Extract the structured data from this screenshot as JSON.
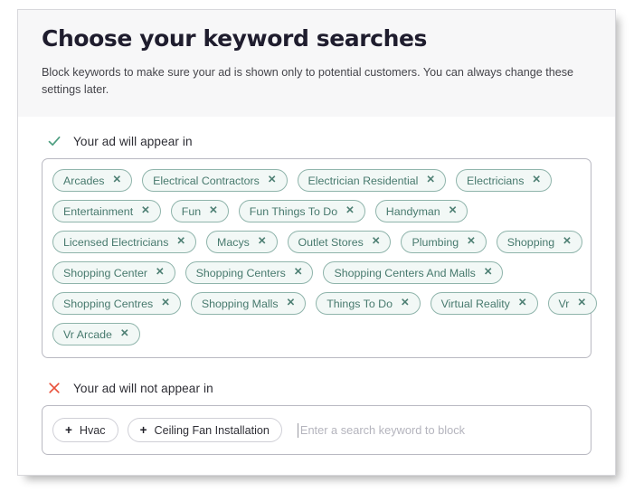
{
  "header": {
    "title": "Choose your keyword searches",
    "description": "Block keywords to make sure your ad is shown only to potential customers. You can always change these settings later."
  },
  "included": {
    "icon": "check-icon",
    "icon_color": "#4d9e80",
    "label": "Your ad will appear in",
    "remove_glyph": "✕",
    "rows": [
      [
        "Arcades",
        "Electrical Contractors",
        "Electrician Residential",
        "Electricians"
      ],
      [
        "Entertainment",
        "Fun",
        "Fun Things To Do",
        "Handyman"
      ],
      [
        "Licensed Electricians",
        "Macys",
        "Outlet Stores",
        "Plumbing",
        "Shopping"
      ],
      [
        "Shopping Center",
        "Shopping Centers",
        "Shopping Centers And Malls"
      ],
      [
        "Shopping Centres",
        "Shopping Malls",
        "Things To Do",
        "Virtual Reality",
        "Vr"
      ],
      [
        "Vr Arcade"
      ]
    ]
  },
  "blocked": {
    "icon": "close-icon",
    "icon_color": "#e8503a",
    "label": "Your ad will not appear in",
    "add_glyph": "+",
    "chips": [
      "Hvac",
      "Ceiling Fan Installation"
    ],
    "input_value": "",
    "input_placeholder": "Enter a search keyword to block"
  },
  "colors": {
    "chip_border": "#8fb4ab",
    "chip_bg": "#f2f8f6",
    "chip_text": "#487a6e",
    "title": "#1f1d2e",
    "header_bg": "#f7f7f8"
  }
}
